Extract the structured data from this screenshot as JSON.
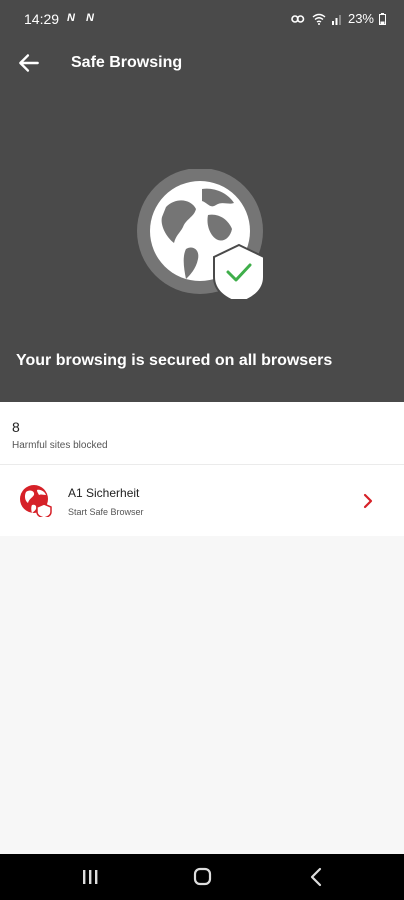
{
  "status_bar": {
    "time": "14:29",
    "battery": "23%"
  },
  "header": {
    "title": "Safe Browsing"
  },
  "hero": {
    "message": "Your browsing is secured on all browsers"
  },
  "stats": {
    "count": "8",
    "label": "Harmful sites blocked"
  },
  "app_row": {
    "name": "A1 Sicherheit",
    "subtitle": "Start Safe Browser"
  },
  "colors": {
    "header_bg": "#4a4a4a",
    "accent": "#d62128",
    "check": "#3fae4a"
  },
  "icons": [
    "back-arrow-icon",
    "globe-shield-icon",
    "checkmark-icon",
    "globe-icon",
    "chevron-right-icon",
    "recents-icon",
    "home-icon",
    "back-icon"
  ]
}
